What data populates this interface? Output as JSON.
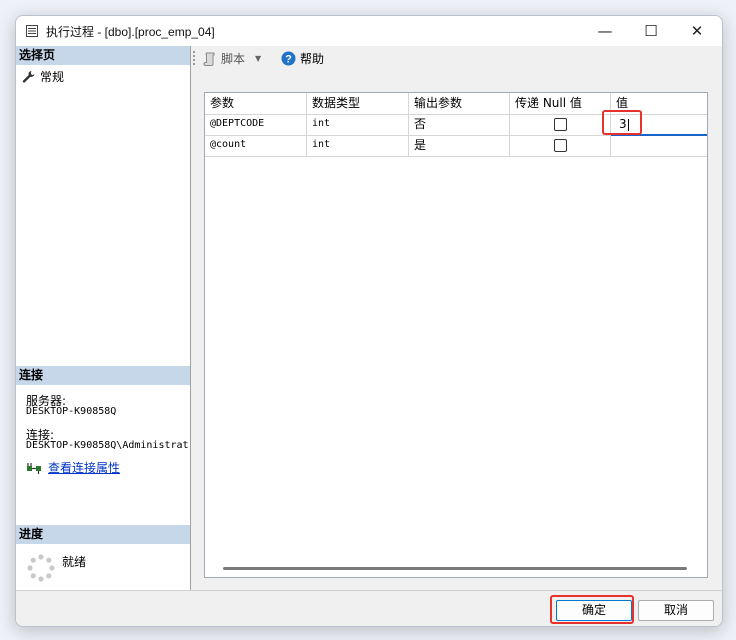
{
  "window": {
    "title": "执行过程 - [dbo].[proc_emp_04]",
    "minimize_glyph": "—",
    "maximize_glyph": "☐",
    "close_glyph": "✕"
  },
  "sidebar": {
    "pages_header": "选择页",
    "items": [
      {
        "label": "常规",
        "icon": "wrench-icon"
      }
    ],
    "connection_header": "连接",
    "server_label": "服务器:",
    "server_value": "DESKTOP-K90858Q",
    "connection_label": "连接:",
    "connection_value": "DESKTOP-K90858Q\\Administrat",
    "view_properties_link": "查看连接属性",
    "progress_header": "进度",
    "progress_status": "就绪"
  },
  "toolbar": {
    "script_label": "脚本",
    "help_label": "帮助"
  },
  "grid": {
    "columns": [
      "参数",
      "数据类型",
      "输出参数",
      "传递 Null 值",
      "值"
    ],
    "rows": [
      {
        "param": "@DEPTCODE",
        "type": "int",
        "output": "否",
        "pass_null": false,
        "value": "3"
      },
      {
        "param": "@count",
        "type": "int",
        "output": "是",
        "pass_null": false,
        "value": ""
      }
    ]
  },
  "footer": {
    "ok_label": "确定",
    "cancel_label": "取消"
  },
  "colors": {
    "section_header_bg": "#c7d7ea",
    "highlight": "#e8312c",
    "link": "#0033cc",
    "help_icon": "#1e73c8"
  }
}
